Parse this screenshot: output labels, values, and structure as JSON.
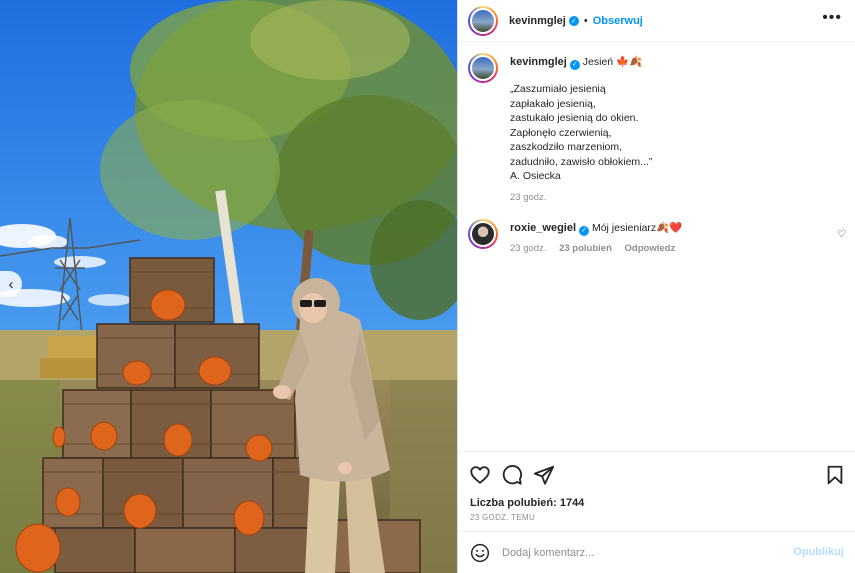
{
  "post": {
    "username": "kevinmglej",
    "follow_label": "Obserwuj",
    "dot": "•",
    "more_label": "•••",
    "verified_mark": "✓"
  },
  "caption": {
    "username": "kevinmglej",
    "title": "Jesień 🍁🍂",
    "lines": [
      "„Zaszumiało jesienią",
      "zapłakało jesienią,",
      "zastukało jesienią do okien.",
      "Zapłonęło czerwienią,",
      "zaszkodziło marzeniom,",
      "zadudniło, zawisło obłokiem...”",
      "A. Osiecka"
    ],
    "time": "23 godz."
  },
  "comment": {
    "username": "roxie_wegiel",
    "text": "Mój jesieniarz🍂❤️",
    "time": "23 godz.",
    "likes": "23 polubień",
    "reply": "Odpowiedz",
    "heart": "♡"
  },
  "stats": {
    "likes_label": "Liczba polubień: 1744",
    "time_ago": "23 GODZ. TEMU"
  },
  "composer": {
    "placeholder": "Dodaj komentarz...",
    "publish_label": "Opublikuj"
  },
  "carousel": {
    "prev_label": "‹"
  },
  "colors": {
    "accent": "#0095f6",
    "publish_disabled": "#b2dffc",
    "muted": "#8e8e8e"
  },
  "icons": [
    "verified-icon",
    "more-icon",
    "heart-icon",
    "comment-icon",
    "share-icon",
    "bookmark-icon",
    "emoji-icon",
    "chevron-left-icon"
  ]
}
